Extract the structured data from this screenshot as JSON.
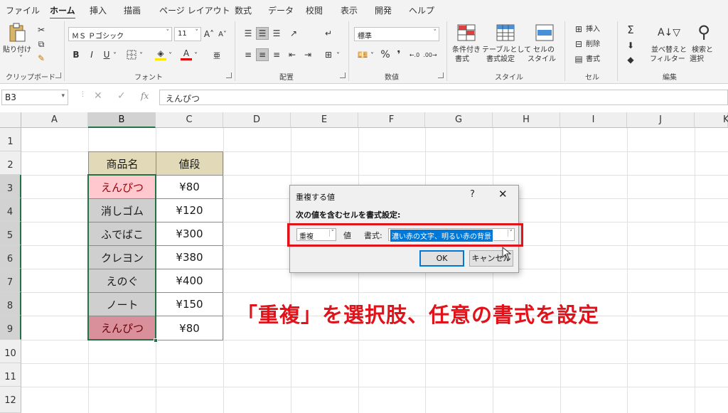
{
  "menu": {
    "tabs": [
      "ファイル",
      "ホーム",
      "挿入",
      "描画",
      "ページ レイアウト",
      "数式",
      "データ",
      "校閲",
      "表示",
      "開発",
      "ヘルプ"
    ]
  },
  "ribbon": {
    "clipboard": {
      "paste_label": "貼り付け",
      "group_label": "クリップボード"
    },
    "font": {
      "font_name": "ＭＳ Ｐゴシック",
      "font_size": "11",
      "bold": "B",
      "italic": "I",
      "underline": "U",
      "grow": "A˄",
      "shrink": "A˅",
      "font_color_glyph": "A",
      "group_label": "フォント"
    },
    "alignment": {
      "group_label": "配置"
    },
    "number": {
      "format": "標準",
      "percent": "%",
      "comma": "❜",
      "group_label": "数値"
    },
    "styles": {
      "cond_format": "条件付き書式",
      "cond_format_1": "条件付き",
      "cond_format_2": "書式",
      "table_format_1": "テーブルとして",
      "table_format_2": "書式設定",
      "cell_style_1": "セルの",
      "cell_style_2": "スタイル",
      "group_label": "スタイル"
    },
    "cells": {
      "insert": "挿入",
      "delete": "削除",
      "format": "書式",
      "group_label": "セル"
    },
    "editing": {
      "sort_1": "並べ替えと",
      "sort_2": "フィルター",
      "find_1": "検索と",
      "find_2": "選択",
      "group_label": "編集"
    }
  },
  "formula_bar": {
    "name_box": "B3",
    "content": "えんぴつ"
  },
  "grid": {
    "columns": [
      "A",
      "B",
      "C",
      "D",
      "E",
      "F",
      "G",
      "H",
      "I",
      "J",
      "K"
    ],
    "rows": [
      "1",
      "2",
      "3",
      "4",
      "5",
      "6",
      "7",
      "8",
      "9",
      "10",
      "11",
      "12"
    ],
    "table": {
      "headers": [
        "商品名",
        "値段"
      ],
      "rows": [
        [
          "えんぴつ",
          "¥80"
        ],
        [
          "消しゴム",
          "¥120"
        ],
        [
          "ふでばこ",
          "¥300"
        ],
        [
          "クレヨン",
          "¥380"
        ],
        [
          "えのぐ",
          "¥400"
        ],
        [
          "ノート",
          "¥150"
        ],
        [
          "えんぴつ",
          "¥80"
        ]
      ]
    }
  },
  "dialog": {
    "title": "重複する値",
    "help": "?",
    "close": "✕",
    "instruction": "次の値を含むセルを書式設定:",
    "type_value": "重複",
    "value_label": "値",
    "format_label": "書式:",
    "format_value": "濃い赤の文字、明るい赤の背景",
    "ok": "OK",
    "cancel": "キャンセル"
  },
  "caption": "「重複」を選択肢、任意の書式を設定",
  "colors": {
    "accent_green": "#217346",
    "header_fill": "#e1d9b8",
    "duplicate_fill": "#ffc7ce",
    "duplicate_text": "#9c0006",
    "selection_gray": "#cfcfcf",
    "caption_red": "#e0121a",
    "focus_blue": "#0078d7"
  },
  "icons": [
    "paste-icon",
    "scissors-icon",
    "copy-icon",
    "format-painter-icon",
    "borders-icon",
    "fill-color-icon",
    "font-color-icon",
    "align-icon",
    "wrap-text-icon",
    "merge-icon",
    "currency-icon",
    "percent-icon",
    "comma-icon",
    "conditional-format-icon",
    "table-format-icon",
    "cell-styles-icon",
    "insert-cells-icon",
    "delete-cells-icon",
    "format-cells-icon",
    "sum-icon",
    "fill-icon",
    "clear-icon",
    "sort-filter-icon",
    "find-icon",
    "cancel-icon",
    "check-icon",
    "fx-icon"
  ]
}
